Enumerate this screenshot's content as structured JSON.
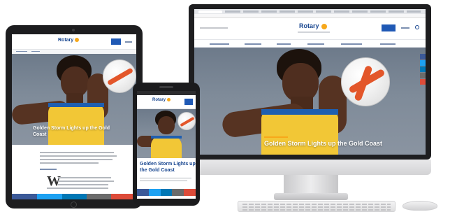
{
  "brand": {
    "logo_text": "Rotary",
    "accent": "#1f59b5",
    "gold": "#f7a81b",
    "navy": "#17458f",
    "singlet_yellow": "#f2c736",
    "ball_stripe": "#e3562a"
  },
  "hero": {
    "headline": "Golden Storm Lights up the Gold Coast"
  },
  "phone": {
    "headline_line1": "Golden Storm Lights up",
    "headline_line2": "the Gold Coast"
  },
  "tablet": {
    "headline_line1": "Golden Storm Lights up the Gold",
    "headline_line2": "Coast"
  },
  "article": {
    "dropcap": "W"
  },
  "icons": {
    "facebook": "facebook-icon",
    "twitter": "twitter-icon",
    "linkedin": "linkedin-icon",
    "email": "email-icon",
    "search": "search-icon"
  },
  "share_colors": [
    "#3b5998",
    "#1da1f2",
    "#0077b5",
    "#6b6b6b",
    "#dd4b39"
  ]
}
